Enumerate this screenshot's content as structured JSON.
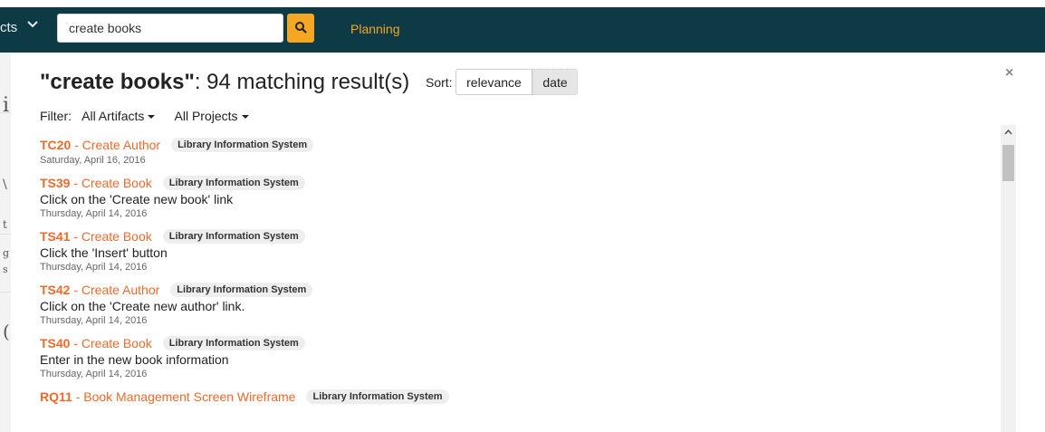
{
  "topbar": {
    "nav_partial": "cts",
    "search_value": "create books",
    "planning_label": "Planning"
  },
  "background_page": {
    "chars": [
      "i",
      "\\",
      "t",
      "g",
      "s",
      "("
    ]
  },
  "results": {
    "query": "\"create books\"",
    "summary": ": 94 matching result(s)",
    "sort_label": "Sort:",
    "sort_options": [
      "relevance",
      "date"
    ],
    "sort_selected": "date",
    "filter_label": "Filter:",
    "filter_artifacts": "All Artifacts",
    "filter_projects": "All Projects",
    "close_label": "×",
    "items": [
      {
        "code": "TC20",
        "title": " - Create Author",
        "project": "Library Information System",
        "description": "",
        "date": "Saturday, April 16, 2016"
      },
      {
        "code": "TS39",
        "title": " - Create Book",
        "project": "Library Information System",
        "description": "Click on the 'Create new book' link",
        "date": "Thursday, April 14, 2016"
      },
      {
        "code": "TS41",
        "title": " - Create Book",
        "project": "Library Information System",
        "description": "Click the 'Insert' button",
        "date": "Thursday, April 14, 2016"
      },
      {
        "code": "TS42",
        "title": " - Create Author",
        "project": "Library Information System",
        "description": "Click on the 'Create new author' link.",
        "date": "Thursday, April 14, 2016"
      },
      {
        "code": "TS40",
        "title": " - Create Book",
        "project": "Library Information System",
        "description": "Enter in the new book information",
        "date": "Thursday, April 14, 2016"
      },
      {
        "code": "RQ11",
        "title": " - Book Management Screen Wireframe",
        "project": "Library Information System",
        "description": "",
        "date": ""
      }
    ]
  },
  "colors": {
    "topbar": "#0e3a46",
    "accent": "#f5a623",
    "link": "#f06a2c"
  }
}
